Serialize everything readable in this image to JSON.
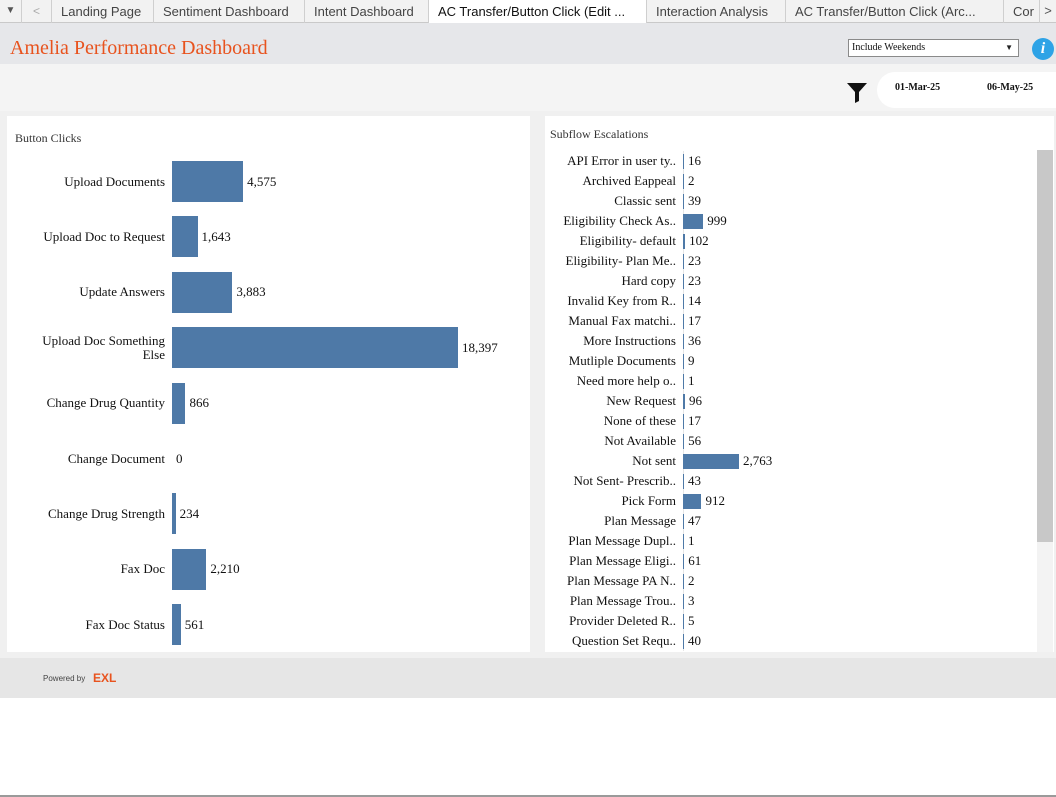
{
  "tabs": {
    "items": [
      {
        "label": "Landing Page"
      },
      {
        "label": "Sentiment Dashboard"
      },
      {
        "label": "Intent Dashboard"
      },
      {
        "label": "AC Transfer/Button Click (Edit ..."
      },
      {
        "label": "Interaction Analysis"
      },
      {
        "label": "AC Transfer/Button Click (Arc..."
      },
      {
        "label": "Cor"
      }
    ],
    "active_index": 3,
    "menu_glyph": "▼",
    "prev_glyph": "<",
    "next_glyph": ">"
  },
  "header": {
    "title": "Amelia Performance Dashboard",
    "weekend_select_value": "Include Weekends",
    "info_icon": "info-icon",
    "title_color": "#e8531e",
    "info_color": "#2ea3e6"
  },
  "filters": {
    "start_date": "01-Mar-25",
    "end_date": "06-May-25",
    "filter_icon": "funnel-icon"
  },
  "button_clicks": {
    "title": "Button Clicks",
    "bar_color": "#4e79a7"
  },
  "subflow": {
    "title": "Subflow Escalations"
  },
  "chart_data": [
    {
      "type": "bar",
      "orientation": "horizontal",
      "title": "Button Clicks",
      "categories": [
        "Upload Documents",
        "Upload Doc to Request",
        "Update Answers",
        "Upload Doc Something Else",
        "Change Drug Quantity",
        "Change Document",
        "Change Drug Strength",
        "Fax Doc",
        "Fax Doc Status"
      ],
      "values": [
        4575,
        1643,
        3883,
        18397,
        866,
        0,
        234,
        2210,
        561
      ],
      "value_labels": [
        "4,575",
        "1,643",
        "3,883",
        "18,397",
        "866",
        "0",
        "234",
        "2,210",
        "561"
      ],
      "xlim": [
        0,
        18397
      ],
      "grid": false
    },
    {
      "type": "bar",
      "orientation": "horizontal",
      "title": "Subflow Escalations",
      "categories": [
        "API Error in user ty..",
        "Archived Eappeal",
        "Classic sent",
        "Eligibility Check As..",
        "Eligibility- default",
        "Eligibility- Plan Me..",
        "Hard copy",
        "Invalid Key from R..",
        "Manual Fax matchi..",
        "More Instructions",
        "Mutliple Documents",
        "Need more help o..",
        "New Request",
        "None of these",
        "Not Available",
        "Not sent",
        "Not Sent- Prescrib..",
        "Pick Form",
        "Plan Message",
        "Plan Message Dupl..",
        "Plan Message Eligi..",
        "Plan Message PA N..",
        "Plan Message Trou..",
        "Provider Deleted R..",
        "Question Set Requ.."
      ],
      "values": [
        16,
        2,
        39,
        999,
        102,
        23,
        23,
        14,
        17,
        36,
        9,
        1,
        96,
        17,
        56,
        2763,
        43,
        912,
        47,
        1,
        61,
        2,
        3,
        5,
        40
      ],
      "value_labels": [
        "16",
        "2",
        "39",
        "999",
        "102",
        "23",
        "23",
        "14",
        "17",
        "36",
        "9",
        "1",
        "96",
        "17",
        "56",
        "2,763",
        "43",
        "912",
        "47",
        "1",
        "61",
        "2",
        "3",
        "5",
        "40"
      ],
      "xlim": [
        0,
        2763
      ],
      "grid": false
    }
  ],
  "footer": {
    "powered_by": "Powered by",
    "brand": "EXL"
  }
}
